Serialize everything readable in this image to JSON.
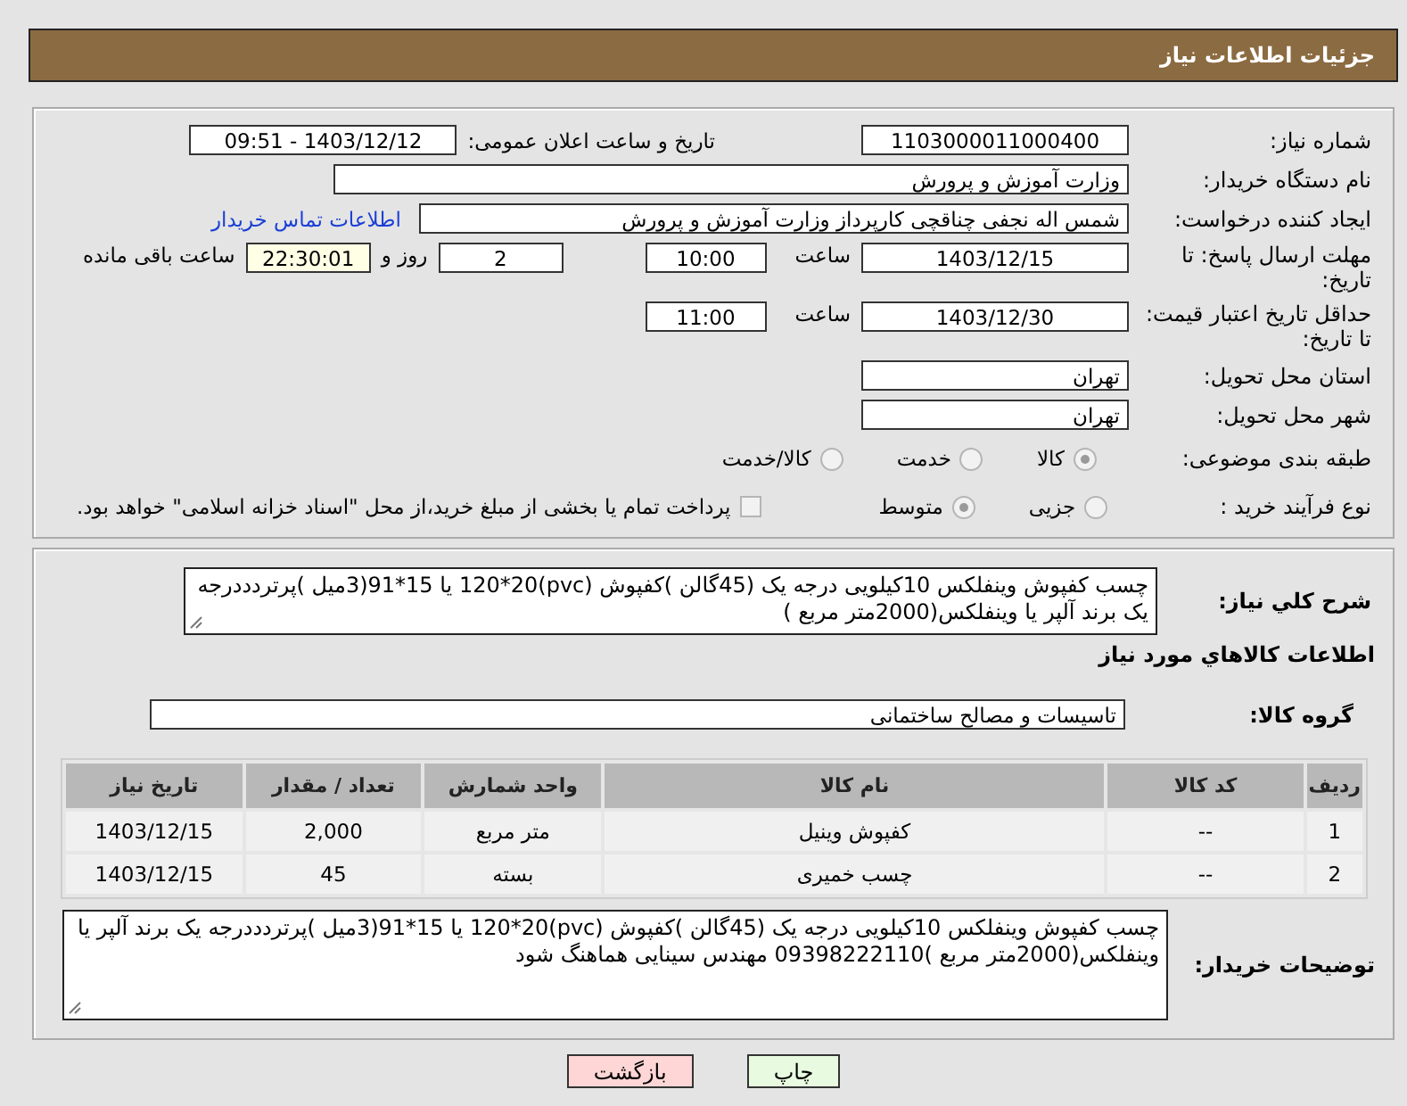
{
  "header": {
    "title": "جزئیات اطلاعات نیاز"
  },
  "form": {
    "need_number": {
      "label": "شماره نیاز:",
      "value": "1103000011000400"
    },
    "announce": {
      "label": "تاریخ و ساعت اعلان عمومی:",
      "value": "1403/12/12 - 09:51"
    },
    "buyer_org": {
      "label": "نام دستگاه خریدار:",
      "value": "وزارت آموزش و پرورش"
    },
    "requester": {
      "label": "ایجاد کننده درخواست:",
      "value": "شمس اله نجفی چناقچی کارپرداز وزارت آموزش و پرورش",
      "link": "اطلاعات تماس خریدار"
    },
    "reply_deadline": {
      "label": "مهلت ارسال پاسخ: تا تاریخ:",
      "date": "1403/12/15",
      "time_label": "ساعت",
      "time": "10:00",
      "days": "2",
      "days_label": "روز و",
      "remaining": "22:30:01",
      "remaining_label": "ساعت باقی مانده"
    },
    "price_validity": {
      "label": "حداقل تاریخ اعتبار قیمت: تا تاریخ:",
      "date": "1403/12/30",
      "time_label": "ساعت",
      "time": "11:00"
    },
    "province": {
      "label": "استان محل تحویل:",
      "value": "تهران"
    },
    "city": {
      "label": "شهر محل تحویل:",
      "value": "تهران"
    },
    "category": {
      "label": "طبقه بندی موضوعی:",
      "options": [
        {
          "label": "کالا",
          "selected": true
        },
        {
          "label": "خدمت",
          "selected": false
        },
        {
          "label": "کالا/خدمت",
          "selected": false
        }
      ]
    },
    "purchase_type": {
      "label": "نوع فرآیند خرید :",
      "options": [
        {
          "label": "جزیی",
          "selected": false
        },
        {
          "label": "متوسط",
          "selected": true
        }
      ],
      "payment": {
        "label": "پرداخت تمام یا بخشی از مبلغ خرید،از محل \"اسناد خزانه اسلامی\" خواهد بود.",
        "checked": false
      }
    }
  },
  "summary": {
    "label": "شرح کلي نياز:",
    "value": "چسب کفپوش وینفلکس 10کیلویی درجه یک (45گالن )کفپوش (pvc)120*20 یا 15*91(3میل )پرتردددرجه یک برند آلپر یا وینفلکس(2000متر مربع )"
  },
  "goods_title": "اطلاعات کالاهاي مورد نياز",
  "goods_group": {
    "label": "گروه کالا:",
    "value": "تاسیسات و مصالح ساختمانی"
  },
  "table": {
    "columns": [
      "ردیف",
      "کد کالا",
      "نام کالا",
      "واحد شمارش",
      "تعداد / مقدار",
      "تاریخ نیاز"
    ],
    "rows": [
      [
        "1",
        "--",
        "کفپوش وینیل",
        "متر مربع",
        "2,000",
        "1403/12/15"
      ],
      [
        "2",
        "--",
        "چسب خمیری",
        "بسته",
        "45",
        "1403/12/15"
      ]
    ]
  },
  "buyer_notes": {
    "label": "توضیحات خریدار:",
    "value": "چسب کفپوش وینفلکس 10کیلویی درجه یک (45گالن )کفپوش (pvc)120*20 یا 15*91(3میل )پرتردددرجه یک برند آلپر یا وینفلکس(2000متر مربع )09398222110 مهندس سینایی هماهنگ شود"
  },
  "buttons": [
    {
      "label": "چاپ",
      "kind": "print"
    },
    {
      "label": "بازگشت",
      "kind": "back"
    }
  ]
}
